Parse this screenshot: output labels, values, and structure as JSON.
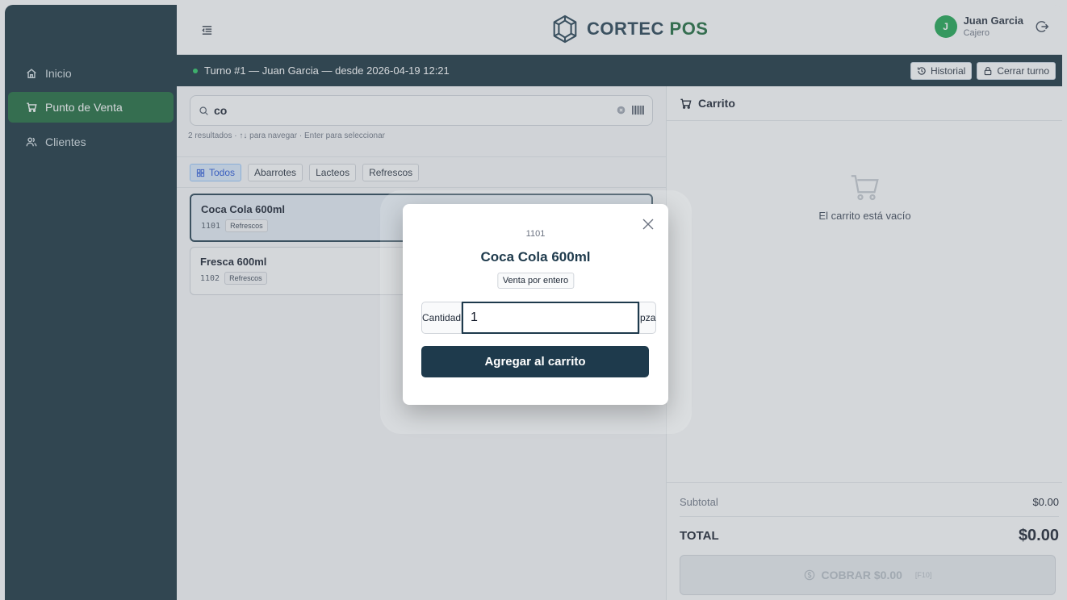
{
  "sidebar": {
    "items": [
      {
        "label": "Inicio",
        "icon": "home-icon"
      },
      {
        "label": "Punto de Venta",
        "icon": "cart-icon"
      },
      {
        "label": "Clientes",
        "icon": "users-icon"
      }
    ]
  },
  "header": {
    "logo_primary": "CORTEC",
    "logo_accent": "POS",
    "user": {
      "initial": "J",
      "name": "Juan Garcia",
      "role": "Cajero"
    }
  },
  "shift": {
    "text": "Turno #1 — Juan Garcia — desde 2026-04-19 12:21",
    "history_label": "Historial",
    "close_label": "Cerrar turno"
  },
  "pos": {
    "search_value": "co",
    "hint": "2 resultados · ↑↓ para navegar · Enter para seleccionar",
    "categories": [
      "Todos",
      "Abarrotes",
      "Lacteos",
      "Refrescos"
    ],
    "products": [
      {
        "name": "Coca Cola 600ml",
        "code": "1101",
        "category": "Refrescos"
      },
      {
        "name": "Fresca 600ml",
        "code": "1102",
        "category": "Refrescos"
      }
    ]
  },
  "cart": {
    "title": "Carrito",
    "empty_text": "El carrito está vacío",
    "subtotal_label": "Subtotal",
    "subtotal_value": "$0.00",
    "total_label": "TOTAL",
    "total_value": "$0.00",
    "pay_label": "COBRAR $0.00",
    "pay_key": "[F10]"
  },
  "modal": {
    "code": "1101",
    "title": "Coca Cola 600ml",
    "badge": "Venta por entero",
    "qty_label": "Cantidad",
    "qty_value": "1",
    "qty_unit": "pza",
    "add_label": "Agregar al carrito"
  },
  "colors": {
    "sidebar": "#0f2a36",
    "active_nav": "#166534",
    "primary": "#1e3a4c",
    "avatar": "#16a34a"
  }
}
